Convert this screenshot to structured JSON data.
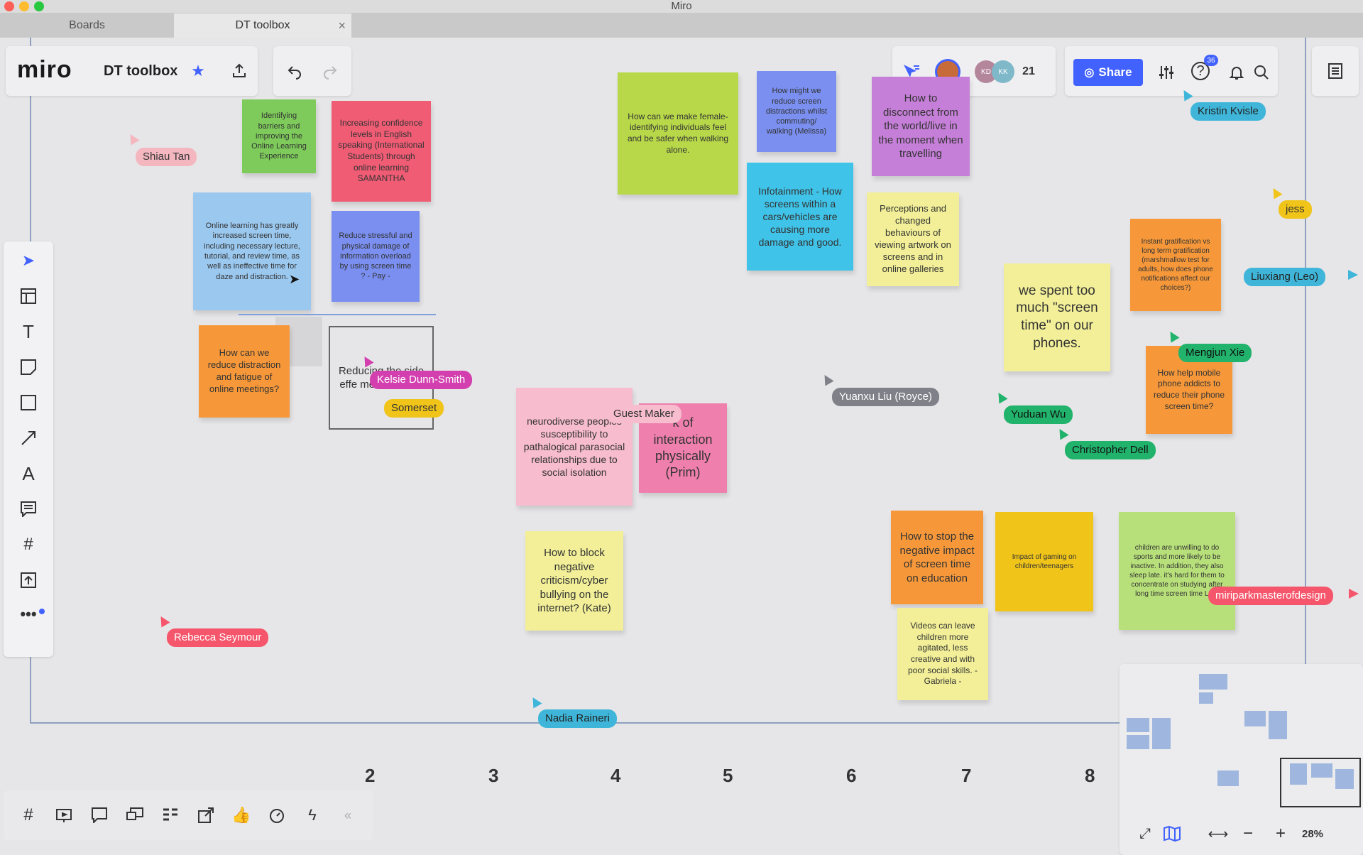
{
  "window": {
    "title": "Miro"
  },
  "tabs": [
    {
      "label": "Boards"
    },
    {
      "label": "DT toolbox"
    }
  ],
  "header": {
    "logo": "miro",
    "board_title": "DT toolbox",
    "collaborator_avatars": [
      "KD",
      "KK"
    ],
    "collaborator_count": "21",
    "share_label": "Share",
    "help_badge": "36"
  },
  "stickies": [
    {
      "text": "Identifying barriers and improving the Online Learning Experience",
      "color": "#7ecb5b"
    },
    {
      "text": "Increasing confidence levels in English speaking (International Students) through online learning SAMANTHA",
      "color": "#ef5c74"
    },
    {
      "text": "Online learning has greatly increased screen time, including necessary lecture, tutorial, and review time, as well as ineffective time for daze and distraction.",
      "color": "#9bc8ef"
    },
    {
      "text": "Reduce stressful and physical damage of information overload by using screen time ? - Pay -",
      "color": "#7a8ff0"
    },
    {
      "text": "How can we reduce distraction and fatigue of online meetings?",
      "color": "#f6983a"
    },
    {
      "text": "Reducing the side effe media China.",
      "color": "#e6e6e8"
    },
    {
      "text": "How can we make female-identifying individuals feel and be safer when walking alone.",
      "color": "#b8d84a"
    },
    {
      "text": "How might we reduce screen distractions whilst commuting/ walking (Melissa)",
      "color": "#7a8ff0"
    },
    {
      "text": "How to disconnect from the world/live in the moment when travelling",
      "color": "#c67fd8"
    },
    {
      "text": "Infotainment - How screens within a cars/vehicles are causing more damage and good.",
      "color": "#3fc3e8"
    },
    {
      "text": "Perceptions and changed behaviours of viewing artwork on screens and in online galleries",
      "color": "#f2ef98"
    },
    {
      "text": "neurodiverse peoples susceptibility to pathalogical parasocial relationships due to social isolation",
      "color": "#f7bccd"
    },
    {
      "text": "k of interaction physically (Prim)",
      "color": "#ef7fad"
    },
    {
      "text": "How to block negative criticism/cyber bullying on the internet? (Kate)",
      "color": "#f2ef98"
    },
    {
      "text": "we spent too much \"screen time\" on our phones.",
      "color": "#f2ef98"
    },
    {
      "text": "Instant gratification vs long term gratification (marshmallow test for adults, how does phone notifications affect our choices?)",
      "color": "#f6983a"
    },
    {
      "text": "How help mobile phone addicts to reduce their phone screen time?",
      "color": "#f6983a"
    },
    {
      "text": "How to stop the negative impact of screen time on education",
      "color": "#f6983a"
    },
    {
      "text": "Impact of gaming on children/teenagers",
      "color": "#f0c419"
    },
    {
      "text": "children are unwilling to do sports and more likely to be inactive. In addition, they also sleep late. it's hard for them to concentrate on studying after long time screen time LEO",
      "color": "#b8e07a"
    },
    {
      "text": "Videos can leave children more agitated, less creative and with poor social skills. - Gabriela -",
      "color": "#f2ef98"
    }
  ],
  "cursors": [
    {
      "name": "Shiau Tan",
      "color": "#f4b7c0"
    },
    {
      "name": "Kelsie Dunn-Smith",
      "color": "#d33fae"
    },
    {
      "name": "Somerset",
      "color": "#f0c419"
    },
    {
      "name": "Guest Maker",
      "color": "#f7bccd"
    },
    {
      "name": "Yuanxu Liu (Royce)",
      "color": "#7f8088"
    },
    {
      "name": "Kristin Kvisle",
      "color": "#3fb6d9"
    },
    {
      "name": "jess",
      "color": "#f0c419"
    },
    {
      "name": "Liuxiang (Leo)",
      "color": "#3fb6d9"
    },
    {
      "name": "Mengjun Xie",
      "color": "#21b36b"
    },
    {
      "name": "Yuduan Wu",
      "color": "#21b36b"
    },
    {
      "name": "Christopher Dell",
      "color": "#21b36b"
    },
    {
      "name": "miriparkmasterofdesign",
      "color": "#f5566b"
    },
    {
      "name": "Rebecca Seymour",
      "color": "#f5566b"
    },
    {
      "name": "Nadia Raineri",
      "color": "#3fb6d9"
    }
  ],
  "column_numbers": [
    "2",
    "3",
    "4",
    "5",
    "6",
    "7",
    "8"
  ],
  "zoom": "28%",
  "colors": {
    "accent": "#4262ff",
    "frame": "#8da0be"
  }
}
